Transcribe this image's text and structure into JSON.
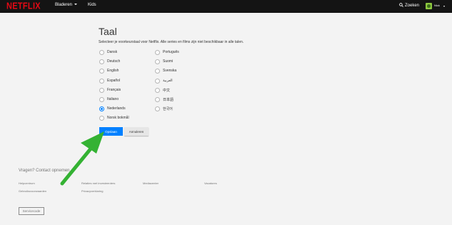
{
  "brand": {
    "logo_text": "NETFLIX",
    "color": "#e50914"
  },
  "nav": {
    "browse_label": "Bladeren",
    "kids_label": "Kids",
    "search_label": "Zoeken",
    "profile_name": "Nick"
  },
  "page": {
    "title": "Taal",
    "description": "Selecteer je voorkeurstaal voor Netflix. Alle series en films zijn niet beschikbaar in alle talen."
  },
  "languages": [
    {
      "label": "Dansk",
      "selected": false
    },
    {
      "label": "Deutsch",
      "selected": false
    },
    {
      "label": "English",
      "selected": false
    },
    {
      "label": "Español",
      "selected": false
    },
    {
      "label": "Français",
      "selected": false
    },
    {
      "label": "Italiano",
      "selected": false
    },
    {
      "label": "Nederlands",
      "selected": true
    },
    {
      "label": "Norsk bokmål",
      "selected": false
    },
    {
      "label": "Português",
      "selected": false
    },
    {
      "label": "Suomi",
      "selected": false
    },
    {
      "label": "Svenska",
      "selected": false
    },
    {
      "label": "العربية",
      "selected": false
    },
    {
      "label": "中文",
      "selected": false
    },
    {
      "label": "日本語",
      "selected": false
    },
    {
      "label": "한국어",
      "selected": false
    }
  ],
  "actions": {
    "save_label": "Opslaan",
    "cancel_label": "Annuleren"
  },
  "footer": {
    "contact_label": "Vragen? Contact opnemen.",
    "links": [
      "Helpcentrum",
      "Relaties met investeerders",
      "Mediacenter",
      "Vacatures",
      "Gebruiksvoorwaarden",
      "Privacyverklaring"
    ],
    "service_code_label": "Servicecode"
  },
  "colors": {
    "accent": "#0080ff",
    "annotation_arrow": "#34b233"
  }
}
